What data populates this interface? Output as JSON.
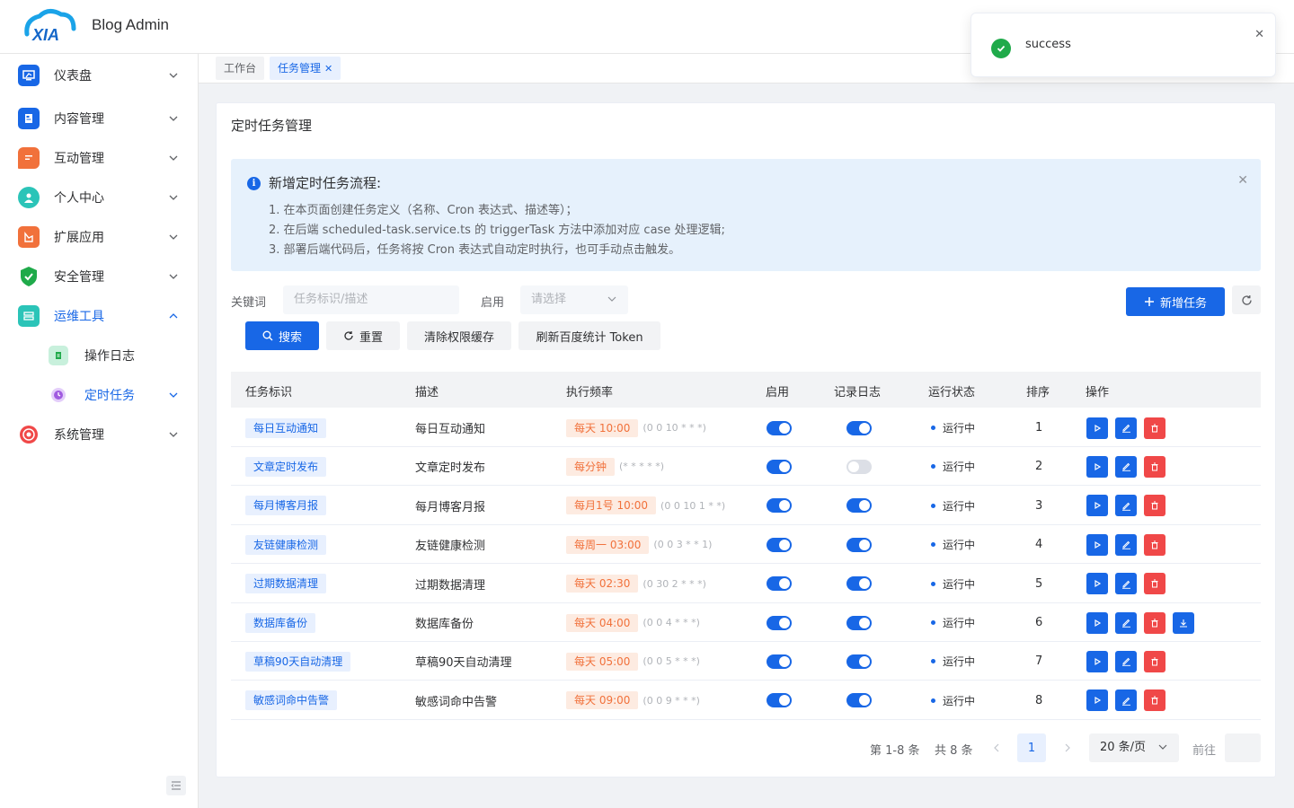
{
  "app": {
    "title": "Blog Admin",
    "logo_text": "XIA"
  },
  "sidebar": {
    "items": [
      {
        "name": "dashboard",
        "label": "仪表盘",
        "icon": "monitor-icon",
        "color": "#1867e6"
      },
      {
        "name": "content",
        "label": "内容管理",
        "icon": "document-icon",
        "color": "#1867e6"
      },
      {
        "name": "interaction",
        "label": "互动管理",
        "icon": "chat-icon",
        "color": "#f1713b"
      },
      {
        "name": "profile",
        "label": "个人中心",
        "icon": "user-icon",
        "color": "#2bc4b8"
      },
      {
        "name": "extensions",
        "label": "扩展应用",
        "icon": "app-icon",
        "color": "#f1713b"
      },
      {
        "name": "security",
        "label": "安全管理",
        "icon": "shield-icon",
        "color": "#1faa4a"
      },
      {
        "name": "ops-tools",
        "label": "运维工具",
        "icon": "server-icon",
        "color": "#2bc4b8"
      },
      {
        "name": "operation-log",
        "label": "操作日志",
        "icon": "log-icon",
        "color": "#1faa4a"
      },
      {
        "name": "scheduled-tasks",
        "label": "定时任务",
        "icon": "clock-icon",
        "color": "#a05be0"
      },
      {
        "name": "system",
        "label": "系统管理",
        "icon": "gear-icon",
        "color": "#f04848"
      }
    ]
  },
  "tabs": [
    {
      "label": "工作台"
    },
    {
      "label": "任务管理",
      "close": "✕"
    }
  ],
  "page": {
    "title": "定时任务管理"
  },
  "alert": {
    "title": "新增定时任务流程:",
    "lines": [
      "1. 在本页面创建任务定义（名称、Cron 表达式、描述等）；",
      "2. 在后端 scheduled-task.service.ts 的 triggerTask 方法中添加对应 case 处理逻辑;",
      "3. 部署后端代码后，任务将按 Cron 表达式自动定时执行，也可手动点击触发。"
    ],
    "close": "✕"
  },
  "filters": {
    "keyword_label": "关键词",
    "keyword_placeholder": "任务标识/描述",
    "enabled_label": "启用",
    "enabled_placeholder": "请选择"
  },
  "buttons": {
    "search": "搜索",
    "reset": "重置",
    "clear_cache": "清除权限缓存",
    "refresh_token": "刷新百度统计 Token",
    "add_task": "新增任务"
  },
  "table": {
    "headers": [
      "任务标识",
      "描述",
      "执行频率",
      "启用",
      "记录日志",
      "运行状态",
      "排序",
      "操作"
    ],
    "rows": [
      {
        "id": "每日互动通知",
        "desc": "每日互动通知",
        "freq": "每天 10:00",
        "cron": "(0 0 10 * * *)",
        "enabled": true,
        "log": true,
        "status": "运行中",
        "order": "1",
        "download": false
      },
      {
        "id": "文章定时发布",
        "desc": "文章定时发布",
        "freq": "每分钟",
        "cron": "(* * * * *)",
        "enabled": true,
        "log": false,
        "status": "运行中",
        "order": "2",
        "download": false
      },
      {
        "id": "每月博客月报",
        "desc": "每月博客月报",
        "freq": "每月1号 10:00",
        "cron": "(0 0 10 1 * *)",
        "enabled": true,
        "log": true,
        "status": "运行中",
        "order": "3",
        "download": false
      },
      {
        "id": "友链健康检测",
        "desc": "友链健康检测",
        "freq": "每周一 03:00",
        "cron": "(0 0 3 * * 1)",
        "enabled": true,
        "log": true,
        "status": "运行中",
        "order": "4",
        "download": false
      },
      {
        "id": "过期数据清理",
        "desc": "过期数据清理",
        "freq": "每天 02:30",
        "cron": "(0 30 2 * * *)",
        "enabled": true,
        "log": true,
        "status": "运行中",
        "order": "5",
        "download": false
      },
      {
        "id": "数据库备份",
        "desc": "数据库备份",
        "freq": "每天 04:00",
        "cron": "(0 0 4 * * *)",
        "enabled": true,
        "log": true,
        "status": "运行中",
        "order": "6",
        "download": true
      },
      {
        "id": "草稿90天自动清理",
        "desc": "草稿90天自动清理",
        "freq": "每天 05:00",
        "cron": "(0 0 5 * * *)",
        "enabled": true,
        "log": true,
        "status": "运行中",
        "order": "7",
        "download": false
      },
      {
        "id": "敏感词命中告警",
        "desc": "敏感词命中告警",
        "freq": "每天 09:00",
        "cron": "(0 0 9 * * *)",
        "enabled": true,
        "log": true,
        "status": "运行中",
        "order": "8",
        "download": false
      }
    ]
  },
  "pagination": {
    "range": "第 1-8 条",
    "total": "共 8 条",
    "current_page": "1",
    "page_size": "20 条/页",
    "goto": "前往"
  },
  "notification": {
    "text": "success",
    "close": "✕"
  },
  "colors": {
    "primary": "#1867e6",
    "danger": "#f04848",
    "success": "#1faa4a",
    "warning": "#f1713b"
  }
}
